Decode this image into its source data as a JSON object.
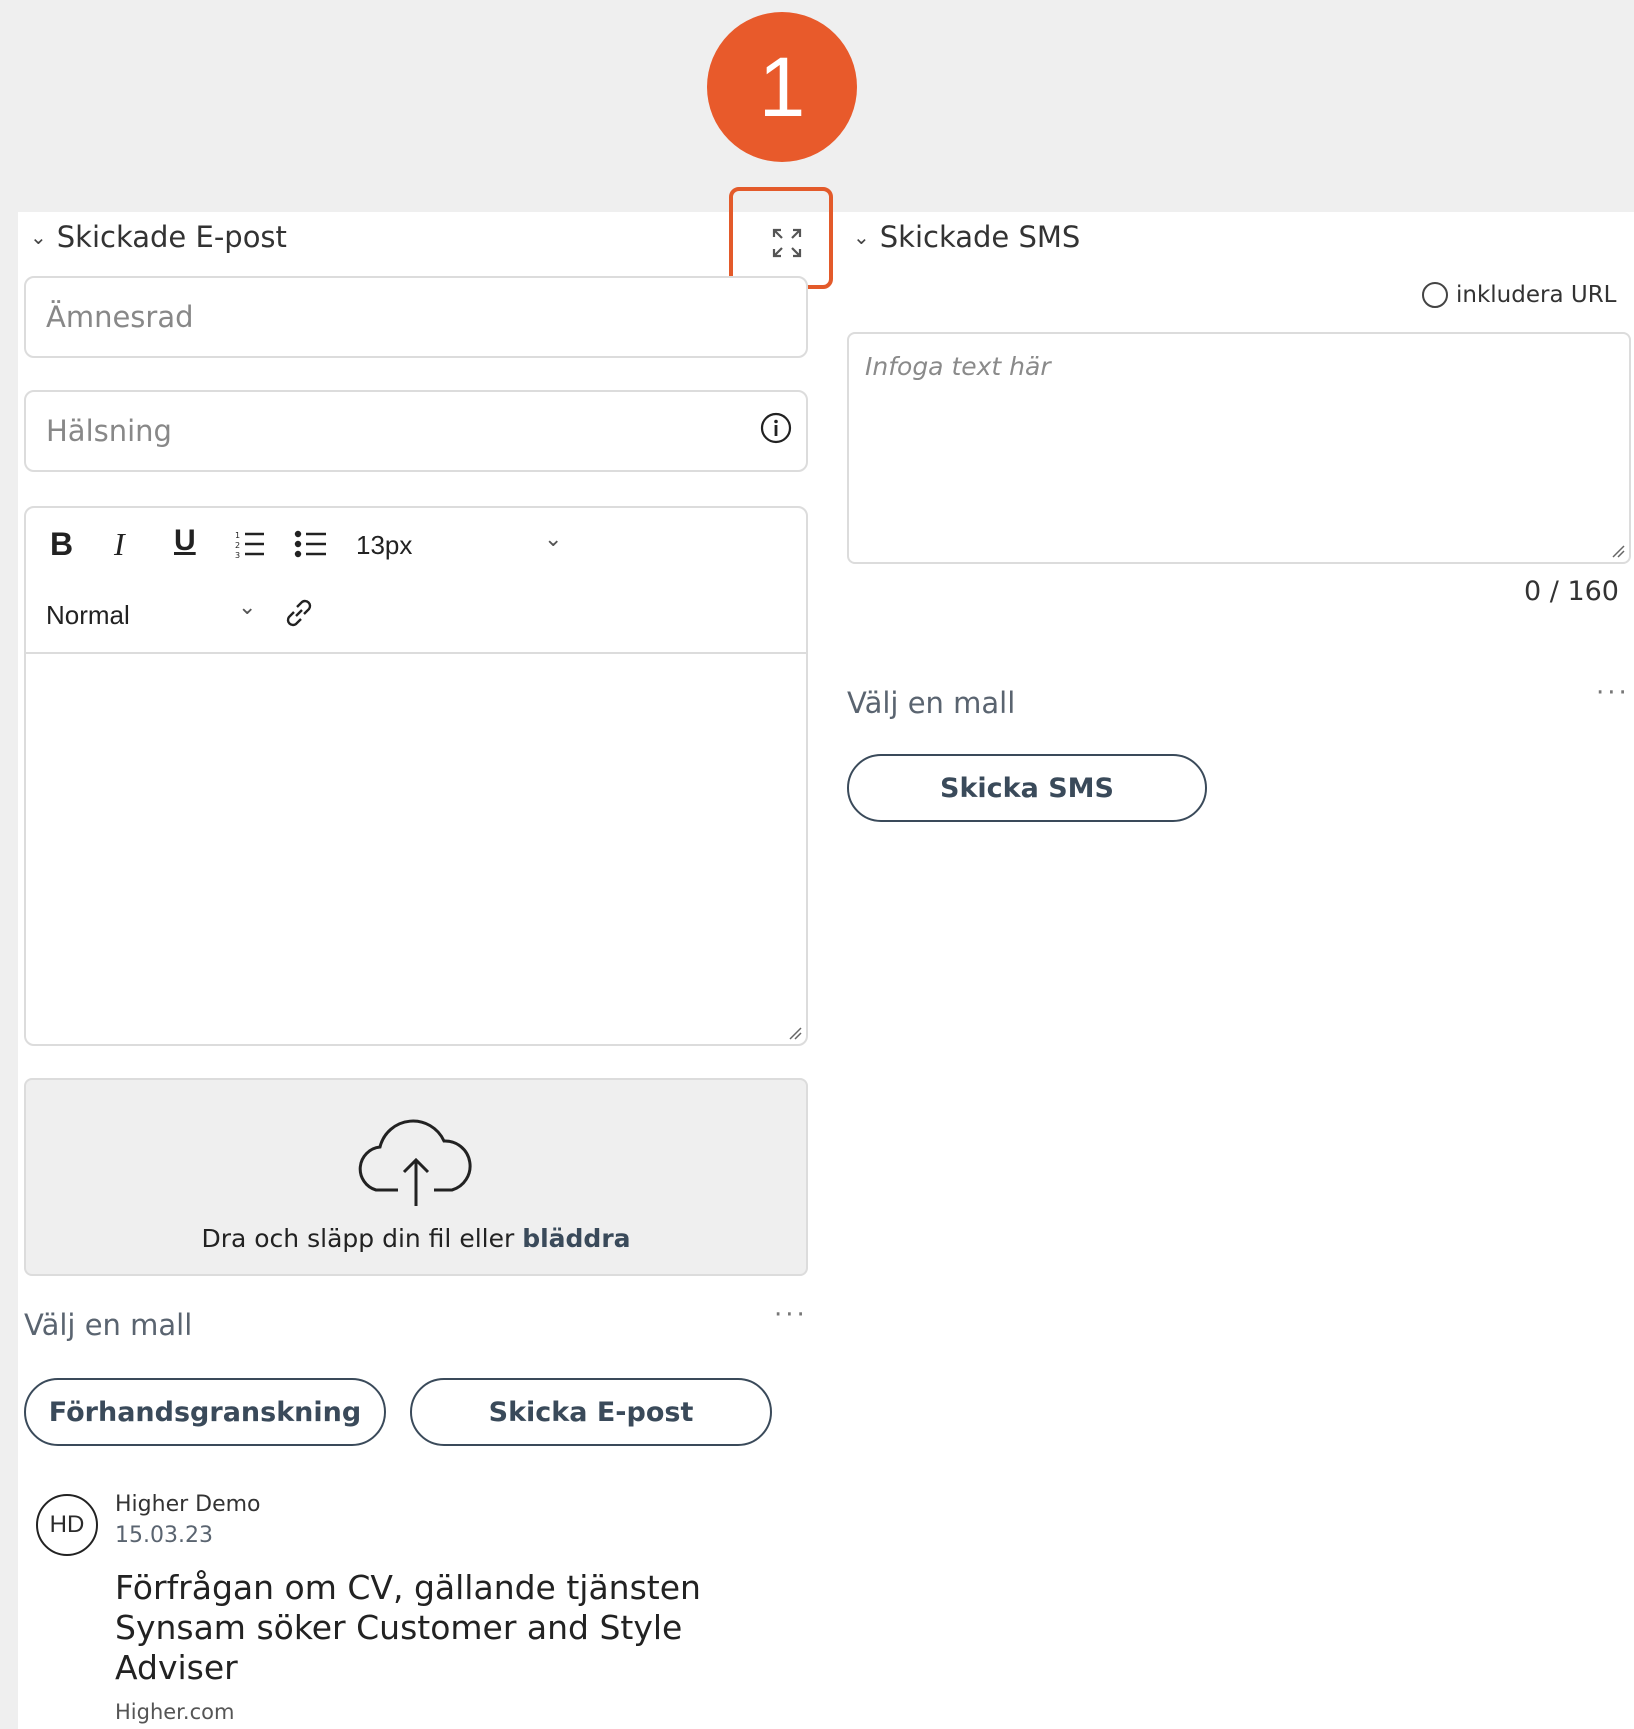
{
  "badge": {
    "number": "1"
  },
  "email_section": {
    "title": "Skickade E-post",
    "subject_placeholder": "Ämnesrad",
    "greeting_placeholder": "Hälsning",
    "toolbar": {
      "bold": "B",
      "italic": "I",
      "underline": "U",
      "font_size": "13px",
      "paragraph_style": "Normal"
    },
    "upload": {
      "text": "Dra och släpp din fil eller",
      "browse": "bläddra"
    },
    "template_label": "Välj en mall",
    "more": "···",
    "preview_button": "Förhandsgranskning",
    "send_button": "Skicka E-post"
  },
  "sms_section": {
    "title": "Skickade SMS",
    "include_url_label": "inkludera URL",
    "text_placeholder": "Infoga text här",
    "counter": "0 / 160",
    "template_label": "Välj en mall",
    "more": "···",
    "send_button": "Skicka SMS"
  },
  "message": {
    "avatar_initials": "HD",
    "sender": "Higher Demo",
    "date": "15.03.23",
    "subject": "Förfrågan om CV, gällande tjänsten Synsam söker Customer and Style Adviser",
    "source": "Higher.com"
  }
}
